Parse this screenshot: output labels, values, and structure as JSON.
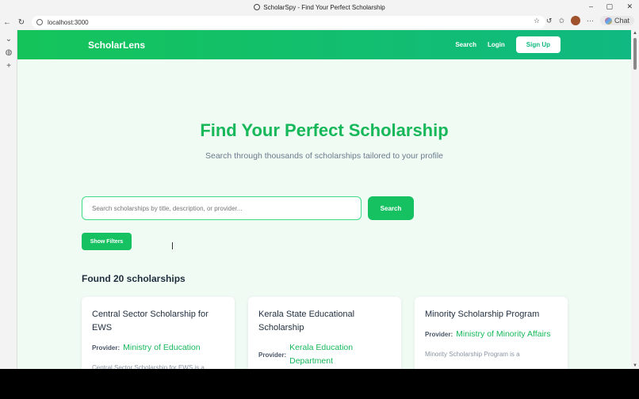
{
  "browser": {
    "window_title": "ScholarSpy - Find Your Perfect Scholarship",
    "url": "localhost:3000",
    "chat_label": "Chat"
  },
  "nav": {
    "brand": "ScholarLens",
    "search": "Search",
    "login": "Login",
    "signup": "Sign Up"
  },
  "hero": {
    "title": "Find Your Perfect Scholarship",
    "subtitle": "Search through thousands of scholarships tailored to your profile"
  },
  "search": {
    "placeholder": "Search scholarships by title, description, or provider...",
    "button": "Search",
    "filters_button": "Show Filters"
  },
  "results": {
    "count_label": "Found 20 scholarships",
    "provider_label": "Provider:",
    "cards": [
      {
        "title": "Central Sector Scholarship for EWS",
        "provider": "Ministry of Education",
        "desc": "Central Sector Scholarship for EWS is a prestigious scholarship program designed to"
      },
      {
        "title": "Kerala State Educational Scholarship",
        "provider": "Kerala Education Department",
        "desc": ""
      },
      {
        "title": "Minority Scholarship Program",
        "provider": "Ministry of Minority Affairs",
        "desc": "Minority Scholarship Program is a"
      }
    ]
  }
}
